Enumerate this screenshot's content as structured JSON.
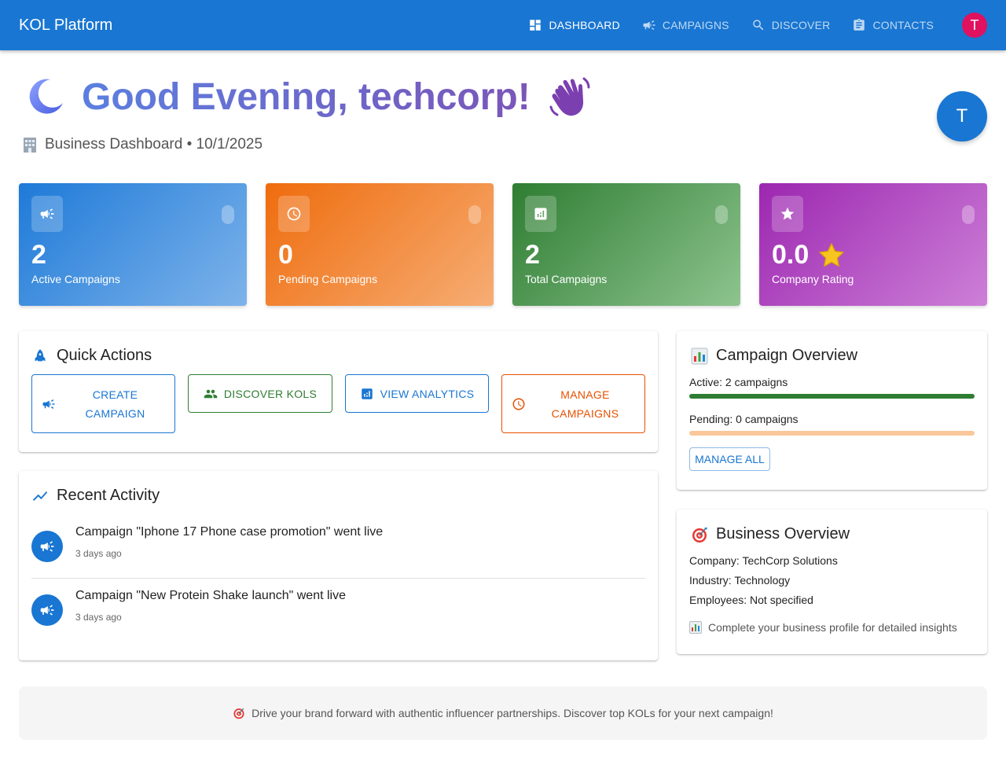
{
  "appbar": {
    "brand": "KOL Platform",
    "nav": [
      {
        "label": "DASHBOARD",
        "icon": "dashboard-icon",
        "active": true
      },
      {
        "label": "CAMPAIGNS",
        "icon": "megaphone-icon",
        "active": false
      },
      {
        "label": "DISCOVER",
        "icon": "search-icon",
        "active": false
      },
      {
        "label": "CONTACTS",
        "icon": "clipboard-icon",
        "active": false
      }
    ],
    "avatar_initial": "T"
  },
  "header": {
    "greeting": "Good Evening, techcorp!",
    "subtitle": "Business Dashboard • 10/1/2025",
    "avatar_initial": "T"
  },
  "stats": [
    {
      "value": "2",
      "label": "Active Campaigns",
      "icon": "megaphone-icon",
      "color_from": "#1e7ad8",
      "color_to": "#7eb3ea"
    },
    {
      "value": "0",
      "label": "Pending Campaigns",
      "icon": "clock-icon",
      "color_from": "#ef6c0d",
      "color_to": "#f6ad74"
    },
    {
      "value": "2",
      "label": "Total Campaigns",
      "icon": "analytics-icon",
      "color_from": "#2e7d32",
      "color_to": "#8ec48f"
    },
    {
      "value": "0.0",
      "label": "Company Rating",
      "icon": "star-icon",
      "color_from": "#9c27b0",
      "color_to": "#cd80d8"
    }
  ],
  "quick_actions": {
    "title": "Quick Actions",
    "buttons": [
      {
        "label": "CREATE CAMPAIGN",
        "icon": "megaphone-icon",
        "color": "#1976d2"
      },
      {
        "label": "DISCOVER KOLS",
        "icon": "people-icon",
        "color": "#2e7d32"
      },
      {
        "label": "VIEW ANALYTICS",
        "icon": "analytics-icon",
        "color": "#1976d2"
      },
      {
        "label": "MANAGE CAMPAIGNS",
        "icon": "clock-icon",
        "color": "#e65100"
      }
    ]
  },
  "recent_activity": {
    "title": "Recent Activity",
    "items": [
      {
        "title": "Campaign \"Iphone 17 Phone case promotion\" went live",
        "time": "3 days ago"
      },
      {
        "title": "Campaign \"New Protein Shake launch\" went live",
        "time": "3 days ago"
      }
    ]
  },
  "campaign_overview": {
    "title": "Campaign Overview",
    "active_label": "Active: 2 campaigns",
    "active_fraction": 1.0,
    "pending_label": "Pending: 0 campaigns",
    "pending_fraction": 0.0,
    "manage_all": "MANAGE ALL"
  },
  "business_overview": {
    "title": "Business Overview",
    "company": "Company: TechCorp Solutions",
    "industry": "Industry: Technology",
    "employees": "Employees: Not specified",
    "hint": "Complete your business profile for detailed insights"
  },
  "footer": {
    "text": "Drive your brand forward with authentic influencer partnerships. Discover top KOLs for your next campaign!"
  }
}
